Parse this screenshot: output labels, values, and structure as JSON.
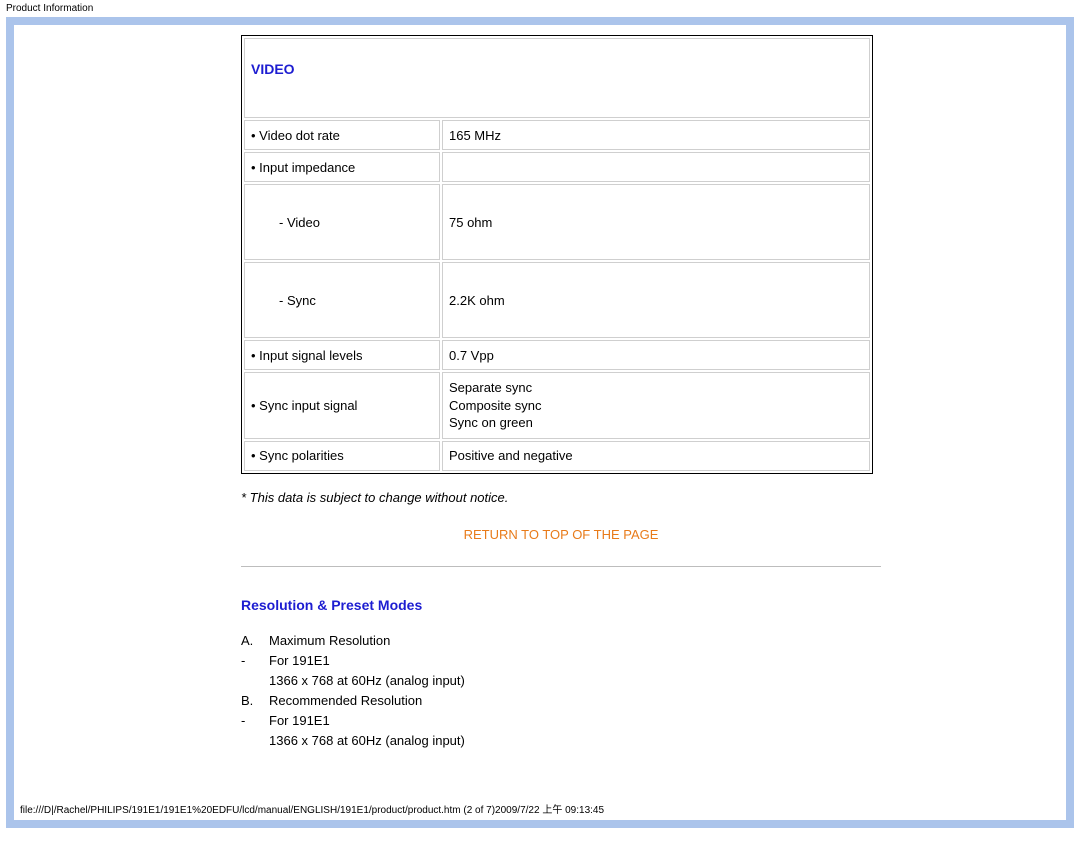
{
  "header": {
    "title": "Product Information"
  },
  "table": {
    "section_title": "VIDEO",
    "rows": [
      {
        "label": "• Video dot rate",
        "value": "165 MHz"
      },
      {
        "label": "• Input impedance",
        "value": ""
      },
      {
        "label_sub": "- Video",
        "value": "75 ohm"
      },
      {
        "label_sub": "- Sync",
        "value": "2.2K ohm"
      },
      {
        "label": "• Input signal levels",
        "value": "0.7 Vpp"
      },
      {
        "label": "• Sync input signal",
        "value_multi": "Separate sync\nComposite sync\nSync on green"
      },
      {
        "label": "• Sync polarities",
        "value": "Positive and negative"
      }
    ]
  },
  "notice": "* This data is subject to change without notice.",
  "return_link": "RETURN TO TOP OF THE PAGE",
  "section2": {
    "heading": "Resolution & Preset Modes",
    "items": [
      {
        "marker": "A.",
        "text": "Maximum Resolution"
      },
      {
        "marker": "-",
        "text": "For 191E1"
      },
      {
        "marker": "",
        "text": "1366 x 768 at 60Hz (analog input)"
      },
      {
        "marker": "B.",
        "text": "Recommended Resolution"
      },
      {
        "marker": "-",
        "text": "For 191E1"
      },
      {
        "marker": "",
        "text": "1366 x 768 at 60Hz (analog input)"
      }
    ]
  },
  "footer": {
    "path": "file:///D|/Rachel/PHILIPS/191E1/191E1%20EDFU/lcd/manual/ENGLISH/191E1/product/product.htm (2 of 7)2009/7/22 上午 09:13:45"
  }
}
